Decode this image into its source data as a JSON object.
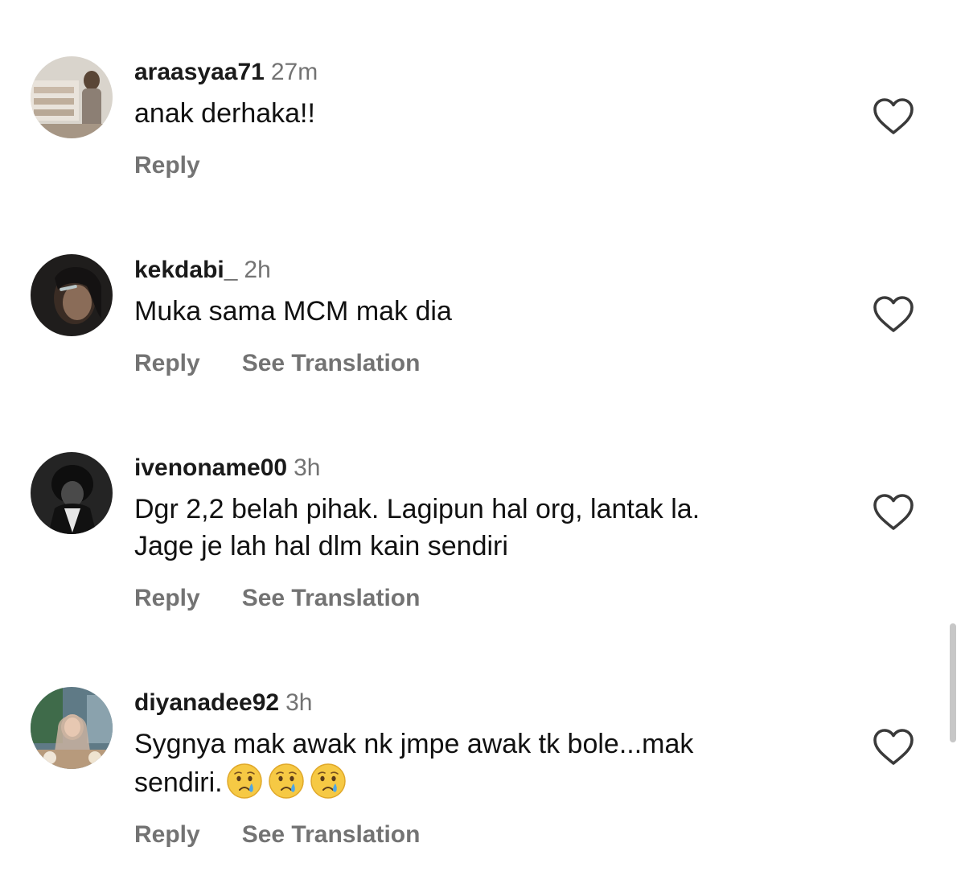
{
  "comments": [
    {
      "username": "araasyaa71",
      "time": "27m",
      "text": "anak derhaka!!",
      "reply_label": "Reply",
      "translate_label": ""
    },
    {
      "username": "kekdabi_",
      "time": "2h",
      "text": "Muka sama MCM mak dia",
      "reply_label": "Reply",
      "translate_label": "See Translation"
    },
    {
      "username": "ivenoname00",
      "time": "3h",
      "text": "Dgr 2,2 belah pihak. Lagipun hal org, lantak la.\nJage je lah hal dlm kain sendiri",
      "reply_label": "Reply",
      "translate_label": "See Translation"
    },
    {
      "username": "diyanadee92",
      "time": "3h",
      "text": "Sygnya mak awak nk jmpe awak tk bole...mak\nsendiri.",
      "emojis": [
        "crying-face-icon",
        "crying-face-icon",
        "crying-face-icon"
      ],
      "reply_label": "Reply",
      "translate_label": "See Translation"
    }
  ],
  "icons": {
    "like": "heart-outline-icon",
    "emoji": "crying-face-icon"
  },
  "colors": {
    "username": "#1a1a1a",
    "secondary_text": "#737373",
    "heart_outline": "#3a3a3a",
    "scrollbar": "#c7c7c7"
  }
}
